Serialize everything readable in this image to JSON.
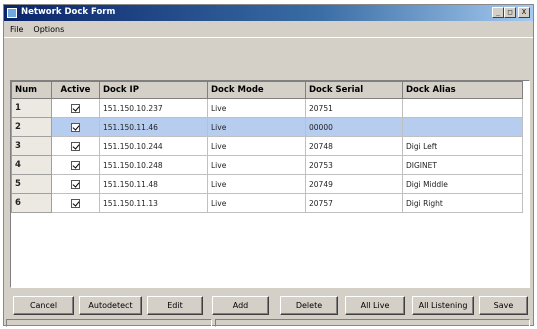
{
  "window": {
    "title": "Network Dock Form",
    "controls": {
      "minimize": "_",
      "maximize": "□",
      "close": "X"
    }
  },
  "menu": {
    "items": [
      "File",
      "Options"
    ]
  },
  "grid": {
    "columns": [
      "Num",
      "Active",
      "Dock IP",
      "Dock Mode",
      "Dock Serial",
      "Dock Alias"
    ],
    "rows": [
      {
        "num": "1",
        "active": true,
        "ip": "151.150.10.237",
        "mode": "Live",
        "serial": "20751",
        "alias": "",
        "selected": false
      },
      {
        "num": "2",
        "active": true,
        "ip": "151.150.11.46",
        "mode": "Live",
        "serial": "00000",
        "alias": "",
        "selected": true
      },
      {
        "num": "3",
        "active": true,
        "ip": "151.150.10.244",
        "mode": "Live",
        "serial": "20748",
        "alias": "Digi Left",
        "selected": false
      },
      {
        "num": "4",
        "active": true,
        "ip": "151.150.10.248",
        "mode": "Live",
        "serial": "20753",
        "alias": "DIGINET",
        "selected": false
      },
      {
        "num": "5",
        "active": true,
        "ip": "151.150.11.48",
        "mode": "Live",
        "serial": "20749",
        "alias": "Digi Middle",
        "selected": false
      },
      {
        "num": "6",
        "active": true,
        "ip": "151.150.11.13",
        "mode": "Live",
        "serial": "20757",
        "alias": "Digi Right",
        "selected": false
      }
    ]
  },
  "buttons": [
    "Cancel",
    "Autodetect",
    "Edit",
    "Add",
    "Delete",
    "All Live",
    "All Listening",
    "Save"
  ],
  "colors": {
    "titlebar": "#0a246a",
    "selected_row": "#b6cdf0",
    "face": "#d4d0c8"
  }
}
